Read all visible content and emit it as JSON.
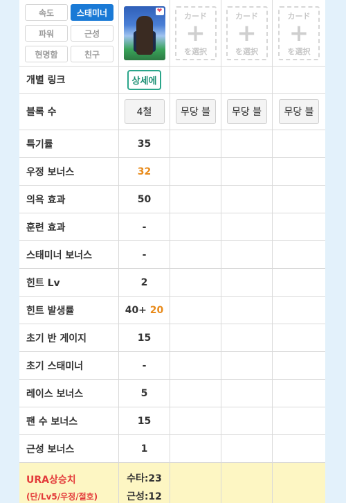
{
  "stat_filters": [
    {
      "label": "속도",
      "active": false
    },
    {
      "label": "스태미너",
      "active": true
    },
    {
      "label": "파워",
      "active": false
    },
    {
      "label": "근성",
      "active": false
    },
    {
      "label": "현명함",
      "active": false
    },
    {
      "label": "친구",
      "active": false
    }
  ],
  "card_slot": {
    "line1": "カード",
    "line2": "を選択"
  },
  "link_row": {
    "label": "개별 링크",
    "button": "상세에"
  },
  "breakthrough_row": {
    "label": "블록 수",
    "value": "4철",
    "empty": "무당 블"
  },
  "rows": [
    {
      "label": "특기률",
      "value": "35"
    },
    {
      "label": "우정 보너스",
      "value": "32"
    },
    {
      "label": "의욕 효과",
      "value": "50"
    },
    {
      "label": "훈련 효과",
      "value": "-"
    },
    {
      "label": "스태미너 보너스",
      "value": "-"
    },
    {
      "label": "힌트 Lv",
      "value": "2"
    },
    {
      "label": "힌트 발생률",
      "value": "40+",
      "extra": "20"
    },
    {
      "label": "초기 반 게이지",
      "value": "15"
    },
    {
      "label": "초기 스태미너",
      "value": "-"
    },
    {
      "label": "레이스 보너스",
      "value": "5"
    },
    {
      "label": "팬 수 보너스",
      "value": "15"
    },
    {
      "label": "근성 보너스",
      "value": "1"
    }
  ],
  "ura": {
    "label": "URA상승치",
    "sub": "(단/Lv5/우정/절호)",
    "line1": "수타:23",
    "line2": "근성:12"
  },
  "colors": {
    "accent": "#1a7ad6",
    "highlight": "#e88a1a",
    "ura_bg": "#fdf6c3",
    "ura_text": "#e33a3a"
  }
}
